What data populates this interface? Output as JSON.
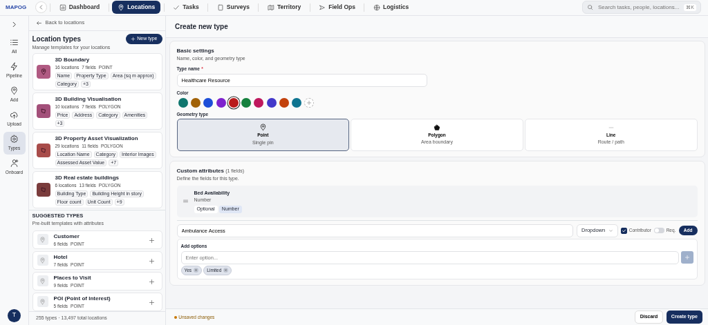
{
  "header": {
    "logo": "MAPOG",
    "nav": [
      {
        "label": "Dashboard",
        "selected": false
      },
      {
        "label": "Locations",
        "selected": true
      },
      {
        "label": "Tasks",
        "selected": false
      },
      {
        "label": "Surveys",
        "selected": false
      },
      {
        "label": "Territory",
        "selected": false
      },
      {
        "label": "Field Ops",
        "selected": false
      },
      {
        "label": "Logistics",
        "selected": false
      }
    ],
    "search": {
      "placeholder": "Search tasks, people, locations...",
      "shortcut": "⌘K"
    }
  },
  "rail": {
    "items": [
      {
        "label": "All",
        "selected": false
      },
      {
        "label": "Pipeline",
        "selected": false
      },
      {
        "label": "Add",
        "selected": false
      },
      {
        "label": "Upload",
        "selected": false
      },
      {
        "label": "Types",
        "selected": true
      },
      {
        "label": "Onboard",
        "selected": false
      }
    ],
    "avatar": "T"
  },
  "left_panel": {
    "back": "Back to locations",
    "title": "Location types",
    "subtitle": "Manage templates for your locations",
    "new_button": "New type",
    "types": [
      {
        "name": "3D Boundary",
        "locations": "16 locations",
        "fields": "7 fields",
        "geometry": "POINT",
        "color": "#b05a82",
        "tags": [
          "Name",
          "Property Type",
          "Area (sq m approx)",
          "Category",
          "+3"
        ]
      },
      {
        "name": "3D Building Visualisation",
        "locations": "10 locations",
        "fields": "7 fields",
        "geometry": "POLYGON",
        "color": "#a3507a",
        "tags": [
          "Price",
          "Address",
          "Category",
          "Amenities",
          "+3"
        ]
      },
      {
        "name": "3D Property Asset Visualization",
        "locations": "29 locations",
        "fields": "11 fields",
        "geometry": "POLYGON",
        "color": "#a84c4a",
        "tags": [
          "Location Name",
          "Category",
          "Interior Images",
          "Assessed Asset Value",
          "+7"
        ]
      },
      {
        "name": "3D Real estate buildings",
        "locations": "6 locations",
        "fields": "13 fields",
        "geometry": "POLYGON",
        "color": "#7a3c3c",
        "tags": [
          "Building Type",
          "Building Height in story",
          "Floor count",
          "Unit Count",
          "+9"
        ]
      }
    ],
    "suggested_title": "SUGGESTED TYPES",
    "suggested_subtitle": "Pre-built templates with attributes",
    "suggested": [
      {
        "name": "Customer",
        "fields": "6 fields",
        "geometry": "POINT"
      },
      {
        "name": "Hotel",
        "fields": "7 fields",
        "geometry": "POINT"
      },
      {
        "name": "Places to Visit",
        "fields": "9 fields",
        "geometry": "POINT"
      },
      {
        "name": "POI (Point of Interest)",
        "fields": "5 fields",
        "geometry": "POINT"
      }
    ],
    "stats": "255 types · 13,497 total locations"
  },
  "main": {
    "title": "Create new type",
    "basic": {
      "title": "Basic settings",
      "subtitle": "Name, color, and geometry type",
      "name_label": "Type name",
      "required_mark": "*",
      "name_value": "Healthcare Resource",
      "color_label": "Color",
      "colors": [
        {
          "color": "#0f766e",
          "selected": false
        },
        {
          "color": "#a16207",
          "selected": false
        },
        {
          "color": "#1d4ed8",
          "selected": false
        },
        {
          "color": "#7e22ce",
          "selected": false
        },
        {
          "color": "#b91c1c",
          "selected": true
        },
        {
          "color": "#15803d",
          "selected": false
        },
        {
          "color": "#be185d",
          "selected": false
        },
        {
          "color": "#4338ca",
          "selected": false
        },
        {
          "color": "#c2410c",
          "selected": false
        },
        {
          "color": "#0e7490",
          "selected": false
        }
      ],
      "geometry_label": "Geometry type",
      "geometries": [
        {
          "kind": "point",
          "label": "Point",
          "hint": "Single pin",
          "selected": true
        },
        {
          "kind": "polygon",
          "label": "Polygon",
          "hint": "Area boundary",
          "selected": false
        },
        {
          "kind": "line",
          "label": "Line",
          "hint": "Route / path",
          "selected": false
        }
      ]
    },
    "custom": {
      "title": "Custom attributes",
      "count": "(1 fields)",
      "subtitle": "Define the fields for this type.",
      "fields": [
        {
          "name": "Bed Availability",
          "type": "Number",
          "tags": [
            "Optional",
            "Number"
          ]
        }
      ],
      "new_field": {
        "value": "Ambulance Access",
        "type": "Dropdown",
        "contributor": {
          "label": "Contributor",
          "checked": true
        },
        "required": {
          "label": "Req.",
          "on": false
        },
        "add_button": "Add"
      },
      "options": {
        "label": "Add options",
        "placeholder": "Enter option...",
        "chips": [
          "Yes",
          "Limited"
        ]
      }
    },
    "footer": {
      "status": "Unsaved changes",
      "discard": "Discard",
      "create": "Create type"
    }
  }
}
